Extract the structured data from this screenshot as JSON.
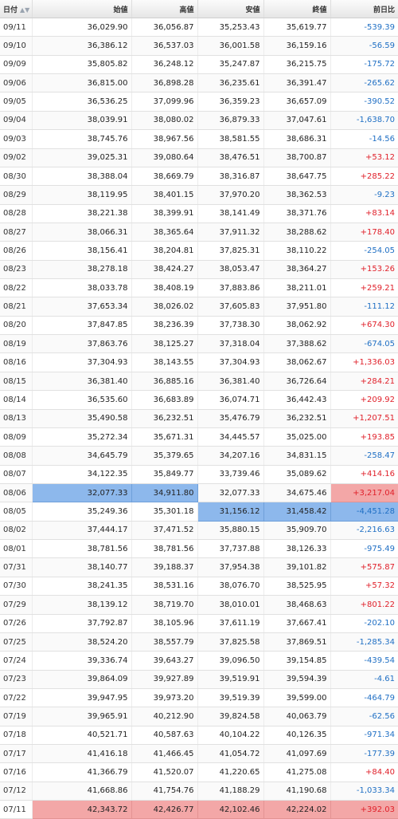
{
  "headers": {
    "date": "日付",
    "open": "始値",
    "high": "高値",
    "low": "安値",
    "close": "終値",
    "change": "前日比"
  },
  "sort_icon": "▲▼",
  "colors": {
    "positive": "#e0202a",
    "negative": "#1f6fc4",
    "highlight_blue": "#8db8ec",
    "highlight_red": "#f3a7a7"
  },
  "rows": [
    {
      "date": "09/11",
      "open": "36,029.90",
      "high": "36,056.87",
      "low": "35,253.43",
      "close": "35,619.77",
      "change": "-539.39"
    },
    {
      "date": "09/10",
      "open": "36,386.12",
      "high": "36,537.03",
      "low": "36,001.58",
      "close": "36,159.16",
      "change": "-56.59"
    },
    {
      "date": "09/09",
      "open": "35,805.82",
      "high": "36,248.12",
      "low": "35,247.87",
      "close": "36,215.75",
      "change": "-175.72"
    },
    {
      "date": "09/06",
      "open": "36,815.00",
      "high": "36,898.28",
      "low": "36,235.61",
      "close": "36,391.47",
      "change": "-265.62"
    },
    {
      "date": "09/05",
      "open": "36,536.25",
      "high": "37,099.96",
      "low": "36,359.23",
      "close": "36,657.09",
      "change": "-390.52"
    },
    {
      "date": "09/04",
      "open": "38,039.91",
      "high": "38,080.02",
      "low": "36,879.33",
      "close": "37,047.61",
      "change": "-1,638.70"
    },
    {
      "date": "09/03",
      "open": "38,745.76",
      "high": "38,967.56",
      "low": "38,581.55",
      "close": "38,686.31",
      "change": "-14.56"
    },
    {
      "date": "09/02",
      "open": "39,025.31",
      "high": "39,080.64",
      "low": "38,476.51",
      "close": "38,700.87",
      "change": "+53.12"
    },
    {
      "date": "08/30",
      "open": "38,388.04",
      "high": "38,669.79",
      "low": "38,316.87",
      "close": "38,647.75",
      "change": "+285.22"
    },
    {
      "date": "08/29",
      "open": "38,119.95",
      "high": "38,401.15",
      "low": "37,970.20",
      "close": "38,362.53",
      "change": "-9.23"
    },
    {
      "date": "08/28",
      "open": "38,221.38",
      "high": "38,399.91",
      "low": "38,141.49",
      "close": "38,371.76",
      "change": "+83.14"
    },
    {
      "date": "08/27",
      "open": "38,066.31",
      "high": "38,365.64",
      "low": "37,911.32",
      "close": "38,288.62",
      "change": "+178.40"
    },
    {
      "date": "08/26",
      "open": "38,156.41",
      "high": "38,204.81",
      "low": "37,825.31",
      "close": "38,110.22",
      "change": "-254.05"
    },
    {
      "date": "08/23",
      "open": "38,278.18",
      "high": "38,424.27",
      "low": "38,053.47",
      "close": "38,364.27",
      "change": "+153.26"
    },
    {
      "date": "08/22",
      "open": "38,033.78",
      "high": "38,408.19",
      "low": "37,883.86",
      "close": "38,211.01",
      "change": "+259.21"
    },
    {
      "date": "08/21",
      "open": "37,653.34",
      "high": "38,026.02",
      "low": "37,605.83",
      "close": "37,951.80",
      "change": "-111.12"
    },
    {
      "date": "08/20",
      "open": "37,847.85",
      "high": "38,236.39",
      "low": "37,738.30",
      "close": "38,062.92",
      "change": "+674.30"
    },
    {
      "date": "08/19",
      "open": "37,863.76",
      "high": "38,125.27",
      "low": "37,318.04",
      "close": "37,388.62",
      "change": "-674.05"
    },
    {
      "date": "08/16",
      "open": "37,304.93",
      "high": "38,143.55",
      "low": "37,304.93",
      "close": "38,062.67",
      "change": "+1,336.03"
    },
    {
      "date": "08/15",
      "open": "36,381.40",
      "high": "36,885.16",
      "low": "36,381.40",
      "close": "36,726.64",
      "change": "+284.21"
    },
    {
      "date": "08/14",
      "open": "36,535.60",
      "high": "36,683.89",
      "low": "36,074.71",
      "close": "36,442.43",
      "change": "+209.92"
    },
    {
      "date": "08/13",
      "open": "35,490.58",
      "high": "36,232.51",
      "low": "35,476.79",
      "close": "36,232.51",
      "change": "+1,207.51"
    },
    {
      "date": "08/09",
      "open": "35,272.34",
      "high": "35,671.31",
      "low": "34,445.57",
      "close": "35,025.00",
      "change": "+193.85"
    },
    {
      "date": "08/08",
      "open": "34,645.79",
      "high": "35,379.65",
      "low": "34,207.16",
      "close": "34,831.15",
      "change": "-258.47"
    },
    {
      "date": "08/07",
      "open": "34,122.35",
      "high": "35,849.77",
      "low": "33,739.46",
      "close": "35,089.62",
      "change": "+414.16"
    },
    {
      "date": "08/06",
      "open": "32,077.33",
      "high": "34,911.80",
      "low": "32,077.33",
      "close": "34,675.46",
      "change": "+3,217.04"
    },
    {
      "date": "08/05",
      "open": "35,249.36",
      "high": "35,301.18",
      "low": "31,156.12",
      "close": "31,458.42",
      "change": "-4,451.28"
    },
    {
      "date": "08/02",
      "open": "37,444.17",
      "high": "37,471.52",
      "low": "35,880.15",
      "close": "35,909.70",
      "change": "-2,216.63"
    },
    {
      "date": "08/01",
      "open": "38,781.56",
      "high": "38,781.56",
      "low": "37,737.88",
      "close": "38,126.33",
      "change": "-975.49"
    },
    {
      "date": "07/31",
      "open": "38,140.77",
      "high": "39,188.37",
      "low": "37,954.38",
      "close": "39,101.82",
      "change": "+575.87"
    },
    {
      "date": "07/30",
      "open": "38,241.35",
      "high": "38,531.16",
      "low": "38,076.70",
      "close": "38,525.95",
      "change": "+57.32"
    },
    {
      "date": "07/29",
      "open": "38,139.12",
      "high": "38,719.70",
      "low": "38,010.01",
      "close": "38,468.63",
      "change": "+801.22"
    },
    {
      "date": "07/26",
      "open": "37,792.87",
      "high": "38,105.96",
      "low": "37,611.19",
      "close": "37,667.41",
      "change": "-202.10"
    },
    {
      "date": "07/25",
      "open": "38,524.20",
      "high": "38,557.79",
      "low": "37,825.58",
      "close": "37,869.51",
      "change": "-1,285.34"
    },
    {
      "date": "07/24",
      "open": "39,336.74",
      "high": "39,643.27",
      "low": "39,096.50",
      "close": "39,154.85",
      "change": "-439.54"
    },
    {
      "date": "07/23",
      "open": "39,864.09",
      "high": "39,927.89",
      "low": "39,519.91",
      "close": "39,594.39",
      "change": "-4.61"
    },
    {
      "date": "07/22",
      "open": "39,947.95",
      "high": "39,973.20",
      "low": "39,519.39",
      "close": "39,599.00",
      "change": "-464.79"
    },
    {
      "date": "07/19",
      "open": "39,965.91",
      "high": "40,212.90",
      "low": "39,824.58",
      "close": "40,063.79",
      "change": "-62.56"
    },
    {
      "date": "07/18",
      "open": "40,521.71",
      "high": "40,587.63",
      "low": "40,104.22",
      "close": "40,126.35",
      "change": "-971.34"
    },
    {
      "date": "07/17",
      "open": "41,416.18",
      "high": "41,466.45",
      "low": "41,054.72",
      "close": "41,097.69",
      "change": "-177.39"
    },
    {
      "date": "07/16",
      "open": "41,366.79",
      "high": "41,520.07",
      "low": "41,220.65",
      "close": "41,275.08",
      "change": "+84.40"
    },
    {
      "date": "07/12",
      "open": "41,668.86",
      "high": "41,754.76",
      "low": "41,188.29",
      "close": "41,190.68",
      "change": "-1,033.34"
    },
    {
      "date": "07/11",
      "open": "42,343.72",
      "high": "42,426.77",
      "low": "42,102.46",
      "close": "42,224.02",
      "change": "+392.03"
    }
  ]
}
